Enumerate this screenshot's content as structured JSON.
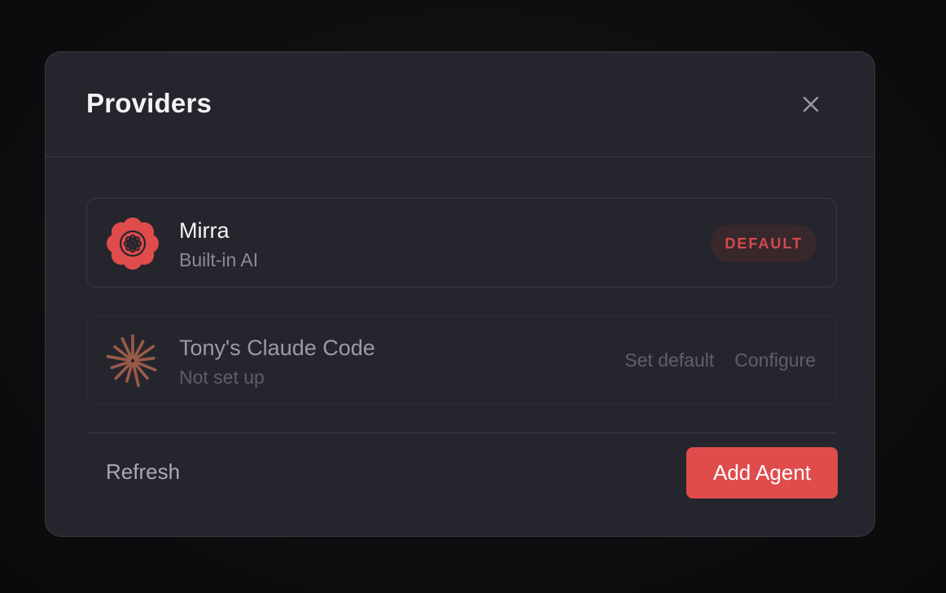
{
  "modal": {
    "title": "Providers",
    "close_icon": "close-icon"
  },
  "providers": [
    {
      "name": "Mirra",
      "subtitle": "Built-in AI",
      "icon": "mirra-flower-icon",
      "icon_color": "#e04c4c",
      "badge": "DEFAULT"
    },
    {
      "name": "Tony's Claude Code",
      "subtitle": "Not set up",
      "icon": "claude-starburst-icon",
      "icon_color": "#9a5a48",
      "actions": [
        "Set default",
        "Configure"
      ]
    }
  ],
  "footer": {
    "refresh_label": "Refresh",
    "add_agent_label": "Add Agent"
  },
  "colors": {
    "accent": "#e04c4c",
    "modal_bg": "#25262d",
    "backdrop": "#0d0d0f"
  }
}
